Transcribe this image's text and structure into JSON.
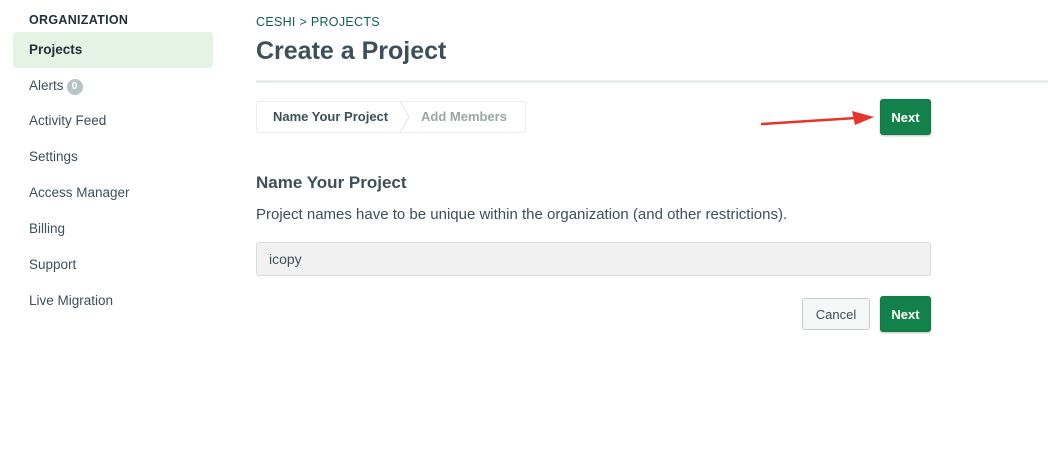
{
  "sidebar": {
    "heading": "ORGANIZATION",
    "items": [
      {
        "label": "Projects",
        "active": true
      },
      {
        "label": "Alerts",
        "badge": "0"
      },
      {
        "label": "Activity Feed"
      },
      {
        "label": "Settings"
      },
      {
        "label": "Access Manager"
      },
      {
        "label": "Billing"
      },
      {
        "label": "Support"
      },
      {
        "label": "Live Migration"
      }
    ]
  },
  "breadcrumb": "CESHI > PROJECTS",
  "page_title": "Create a Project",
  "stepper": {
    "steps": [
      {
        "label": "Name Your Project",
        "state": "current"
      },
      {
        "label": "Add Members",
        "state": "upcoming"
      }
    ]
  },
  "buttons": {
    "next_top": "Next",
    "next_bottom": "Next",
    "cancel": "Cancel"
  },
  "form": {
    "section_title": "Name Your Project",
    "description": "Project names have to be unique within the organization (and other restrictions).",
    "project_name_value": "icopy"
  },
  "colors": {
    "accent_green": "#13824a",
    "active_nav_bg": "#e4f4e4",
    "annotation_arrow": "#e8332a"
  },
  "icons": {
    "annotation": "red-arrow-icon"
  }
}
